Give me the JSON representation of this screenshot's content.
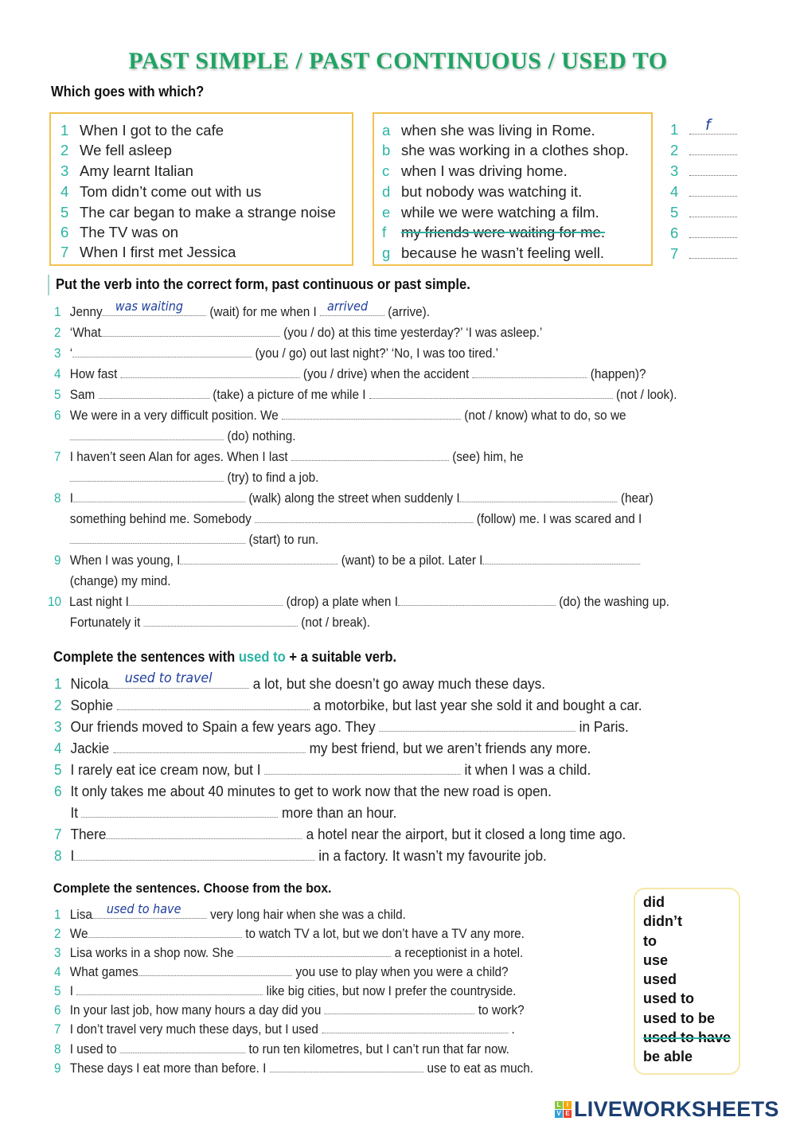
{
  "title": "PAST SIMPLE / PAST CONTINUOUS / USED TO",
  "section1": {
    "heading": "Which goes with which?",
    "left_items": [
      {
        "num": "1",
        "text": "When I got to the cafe"
      },
      {
        "num": "2",
        "text": "We fell asleep"
      },
      {
        "num": "3",
        "text": "Amy learnt Italian"
      },
      {
        "num": "4",
        "text": "Tom didn’t come out with us"
      },
      {
        "num": "5",
        "text": "The car began to make a strange noise"
      },
      {
        "num": "6",
        "text": "The TV was on"
      },
      {
        "num": "7",
        "text": "When I first met Jessica"
      }
    ],
    "right_items": [
      {
        "letter": "a",
        "text": "when she was living in Rome."
      },
      {
        "letter": "b",
        "text": "she was working in a clothes shop."
      },
      {
        "letter": "c",
        "text": "when I was driving home."
      },
      {
        "letter": "d",
        "text": "but nobody was watching it."
      },
      {
        "letter": "e",
        "text": "while we were watching a film."
      },
      {
        "letter": "f",
        "text": "my friends were waiting for me.",
        "struck": true
      },
      {
        "letter": "g",
        "text": "because he wasn’t feeling well."
      }
    ],
    "answers": [
      {
        "num": "1",
        "value": "f"
      },
      {
        "num": "2",
        "value": ""
      },
      {
        "num": "3",
        "value": ""
      },
      {
        "num": "4",
        "value": ""
      },
      {
        "num": "5",
        "value": ""
      },
      {
        "num": "6",
        "value": ""
      },
      {
        "num": "7",
        "value": ""
      }
    ]
  },
  "section2": {
    "heading": "Put the verb into the correct form, past continuous or past simple.",
    "lines": {
      "l1": {
        "num": "1",
        "a": "Jenny",
        "ans1": "was waiting",
        "b": "(wait) for me when I",
        "ans2": "arrived",
        "c": "(arrive)."
      },
      "l2": {
        "num": "2",
        "a": "‘What",
        "b": "(you / do) at this time yesterday?’   ‘I was asleep.’"
      },
      "l3": {
        "num": "3",
        "a": "‘",
        "b": "(you / go) out last night?’   ‘No, I was too tired.’"
      },
      "l4": {
        "num": "4",
        "a": "How fast",
        "b": "(you / drive) when the accident",
        "c": "(happen)?"
      },
      "l5": {
        "num": "5",
        "a": "Sam",
        "b": "(take) a picture of me while I",
        "c": "(not / look)."
      },
      "l6": {
        "num": "6",
        "a": "We were in a very difficult position.  We",
        "b": "(not / know) what to do, so we",
        "c": "(do) nothing."
      },
      "l7": {
        "num": "7",
        "a": "I haven’t seen Alan for ages.  When I last",
        "b": "(see) him, he",
        "c": "(try) to find a job."
      },
      "l8": {
        "num": "8",
        "a": "I",
        "b": "(walk) along the street when suddenly I",
        "c": "(hear)",
        "d": "something behind me.  Somebody",
        "e": "(follow) me.  I was scared and I",
        "f": "(start) to run."
      },
      "l9": {
        "num": "9",
        "a": "When I was young, I",
        "b": "(want) to be a pilot.  Later I",
        "c": "(change) my mind."
      },
      "l10": {
        "num": "10",
        "a": "Last night I",
        "b": "(drop) a plate when I",
        "c": "(do) the washing up.",
        "d": "Fortunately it",
        "e": "(not / break)."
      }
    }
  },
  "section3": {
    "heading_pre": "Complete the sentences with ",
    "heading_hl": "used to",
    "heading_post": " + a suitable verb.",
    "lines": {
      "l1": {
        "num": "1",
        "a": "Nicola",
        "ans": "used to travel",
        "b": "a lot, but she doesn’t go away much these days."
      },
      "l2": {
        "num": "2",
        "a": "Sophie",
        "b": "a motorbike, but last year she sold it and bought a car."
      },
      "l3": {
        "num": "3",
        "a": "Our friends moved to Spain a few years ago.  They",
        "b": "in Paris."
      },
      "l4": {
        "num": "4",
        "a": "Jackie",
        "b": "my best friend, but we aren’t friends any more."
      },
      "l5": {
        "num": "5",
        "a": "I rarely eat ice cream now, but I",
        "b": "it when I was a child."
      },
      "l6": {
        "num": "6",
        "a": "It only takes me about 40 minutes to get to work now that the new road is open.",
        "b": "It",
        "c": "more than an hour."
      },
      "l7": {
        "num": "7",
        "a": "There",
        "b": "a hotel near the airport, but it closed a long time ago."
      },
      "l8": {
        "num": "8",
        "a": "I",
        "b": "in a factory.  It wasn’t my favourite job."
      }
    }
  },
  "section4": {
    "heading": "Complete the sentences.  Choose from the box.",
    "lines": {
      "l1": {
        "num": "1",
        "a": "Lisa",
        "ans": "used to have",
        "b": "very long hair when she was a child."
      },
      "l2": {
        "num": "2",
        "a": "We",
        "b": "to watch TV a lot, but we don’t have a TV any more."
      },
      "l3": {
        "num": "3",
        "a": "Lisa works in a shop now.  She",
        "b": "a receptionist in a hotel."
      },
      "l4": {
        "num": "4",
        "a": "What games",
        "b": "you use to play when you were a child?"
      },
      "l5": {
        "num": "5",
        "a": "I",
        "b": "like big cities, but now I prefer the countryside."
      },
      "l6": {
        "num": "6",
        "a": "In your last job, how many hours a day did you",
        "b": "to work?"
      },
      "l7": {
        "num": "7",
        "a": "I don’t travel very much these days, but I used",
        "b": "."
      },
      "l8": {
        "num": "8",
        "a": "I used to",
        "b": "to run ten kilometres, but I can’t run that far now."
      },
      "l9": {
        "num": "9",
        "a": "These days I eat more than before.  I",
        "b": "use to eat as much."
      }
    },
    "word_box": [
      {
        "word": "did"
      },
      {
        "word": "didn’t"
      },
      {
        "word": "to"
      },
      {
        "word": "use"
      },
      {
        "word": "used"
      },
      {
        "word": "used to"
      },
      {
        "word": "used to be"
      },
      {
        "word": "used to have",
        "struck": true
      },
      {
        "word": "be able"
      }
    ]
  },
  "logo": {
    "badge": [
      "L",
      "I",
      "V",
      "E"
    ],
    "text": "LIVEWORKSHEETS"
  },
  "colors": {
    "title": "#1fa463",
    "accent": "#2bb3a3",
    "box_border": "#f2c14e",
    "handwriting": "#1f3e9c",
    "logo": "#1c3f72"
  }
}
